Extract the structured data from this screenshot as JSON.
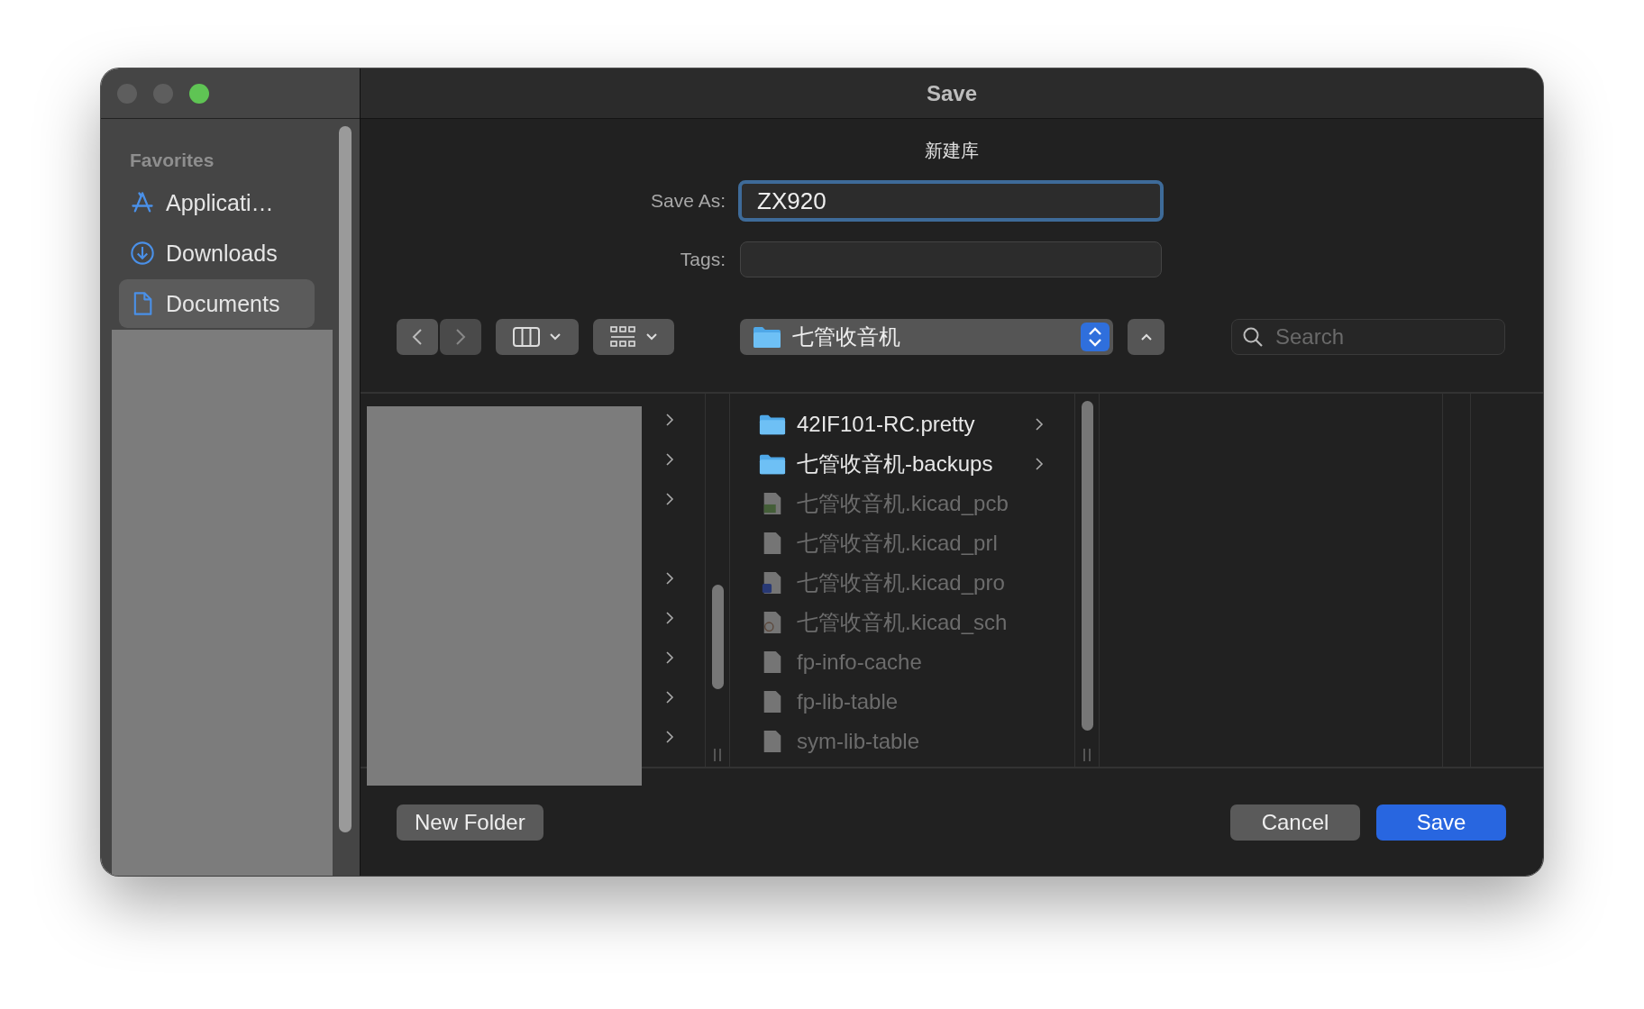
{
  "window": {
    "title": "Save"
  },
  "sidebar": {
    "section": "Favorites",
    "items": [
      {
        "label": "Applicati…",
        "kind": "applications",
        "selected": false
      },
      {
        "label": "Downloads",
        "kind": "downloads",
        "selected": false
      },
      {
        "label": "Documents",
        "kind": "documents",
        "selected": true
      }
    ]
  },
  "form": {
    "subtitle": "新建库",
    "save_as": {
      "label": "Save As:",
      "value": "ZX920"
    },
    "tags": {
      "label": "Tags:"
    }
  },
  "toolbar": {
    "location": "七管收音机",
    "search": {
      "placeholder": "Search"
    }
  },
  "browser": {
    "column_1": [
      {
        "expandable": true
      },
      {
        "expandable": true
      },
      {
        "expandable": true
      },
      {
        "expandable": false
      },
      {
        "expandable": true
      },
      {
        "expandable": true
      },
      {
        "expandable": true
      },
      {
        "expandable": true
      },
      {
        "expandable": true
      }
    ],
    "column_2": [
      {
        "name": "42IF101-RC.pretty",
        "kind": "folder",
        "disabled": false
      },
      {
        "name": "七管收音机-backups",
        "kind": "folder",
        "disabled": false
      },
      {
        "name": "七管收音机.kicad_pcb",
        "kind": "pcb",
        "disabled": true
      },
      {
        "name": "七管收音机.kicad_prl",
        "kind": "document",
        "disabled": true
      },
      {
        "name": "七管收音机.kicad_pro",
        "kind": "project",
        "disabled": true
      },
      {
        "name": "七管收音机.kicad_sch",
        "kind": "schematic",
        "disabled": true
      },
      {
        "name": "fp-info-cache",
        "kind": "document",
        "disabled": true
      },
      {
        "name": "fp-lib-table",
        "kind": "document",
        "disabled": true
      },
      {
        "name": "sym-lib-table",
        "kind": "document",
        "disabled": true
      }
    ]
  },
  "buttons": {
    "new_folder": "New Folder",
    "cancel": "Cancel",
    "save": "Save"
  }
}
